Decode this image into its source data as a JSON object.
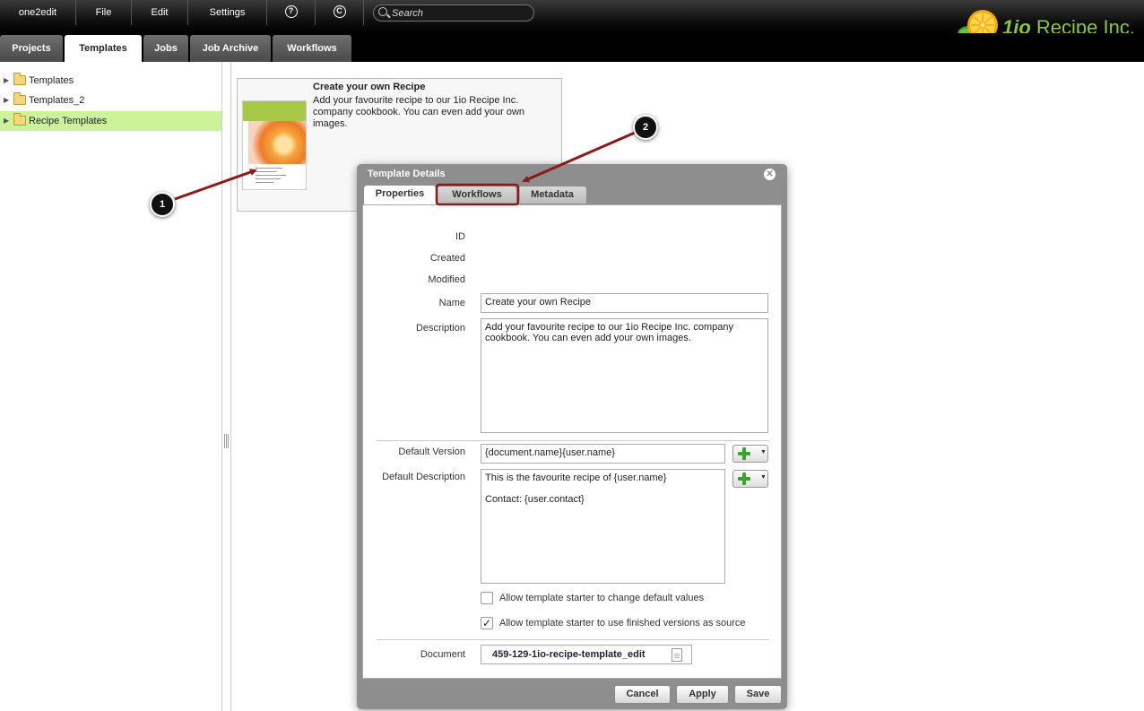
{
  "menubar": {
    "app_name": "one2edit",
    "file": "File",
    "edit": "Edit",
    "settings": "Settings",
    "help_icon": "?",
    "refresh_icon": "C",
    "search_placeholder": "Search"
  },
  "logo": {
    "number": "1io",
    "name": "Recipe Inc."
  },
  "tabs": [
    "Projects",
    "Templates",
    "Jobs",
    "Job Archive",
    "Workflows"
  ],
  "active_tab": "Templates",
  "tree": [
    {
      "label": "Templates",
      "selected": false
    },
    {
      "label": "Templates_2",
      "selected": false
    },
    {
      "label": "Recipe Templates",
      "selected": true
    }
  ],
  "card": {
    "title": "Create your own Recipe",
    "description": "Add your favourite recipe to our 1io Recipe Inc. company cookbook. You can even add your own images."
  },
  "callouts": [
    "1",
    "2"
  ],
  "dialog": {
    "title": "Template Details",
    "tabs": [
      "Properties",
      "Workflows",
      "Metadata"
    ],
    "active_tab": "Properties",
    "labels": {
      "id": "ID",
      "created": "Created",
      "modified": "Modified",
      "name": "Name",
      "description": "Description",
      "default_version": "Default Version",
      "default_description": "Default Description",
      "document": "Document"
    },
    "fields": {
      "name": "Create your own Recipe",
      "description": "Add your favourite recipe to our 1io Recipe Inc. company cookbook. You can even add your own images.",
      "default_version": "{document.name}{user.name}",
      "default_description": "This is the favourite recipe of {user.name}\n\nContact: {user.contact}",
      "document": "459-129-1io-recipe-template_edit"
    },
    "checkboxes": [
      {
        "label": "Allow template starter to change default values",
        "checked": false
      },
      {
        "label": "Allow template starter to use finished versions as source",
        "checked": true
      }
    ],
    "buttons": {
      "cancel": "Cancel",
      "apply": "Apply",
      "save": "Save"
    }
  },
  "colors": {
    "accent_green": "#8cc63f",
    "selection": "#ccf29a",
    "annotation_red": "#8b1a1a"
  }
}
